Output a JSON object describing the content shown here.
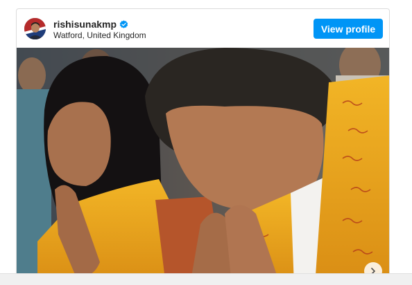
{
  "post": {
    "username": "rishisunakmp",
    "location": "Watford, United Kingdom",
    "view_profile_label": "View profile",
    "verified": true
  },
  "icons": {
    "verified": "verified-badge-icon",
    "next": "chevron-right-icon"
  },
  "colors": {
    "button_blue": "#0095f6",
    "verified_blue": "#0095f6",
    "scarf_saffron": "#e9a51c"
  }
}
